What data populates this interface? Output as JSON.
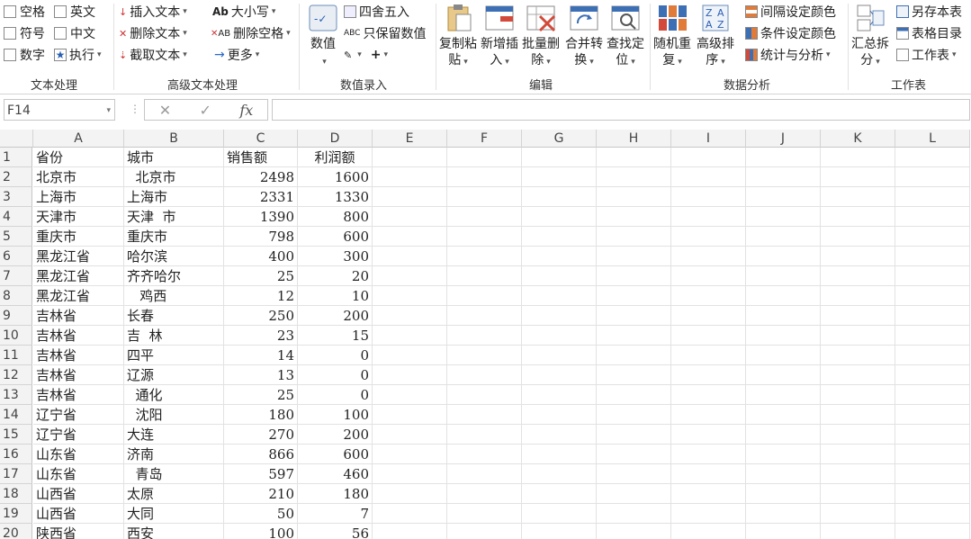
{
  "ribbon": {
    "text_group": {
      "label": "文本处理",
      "items": [
        [
          "空格",
          "英文"
        ],
        [
          "符号",
          "中文"
        ],
        [
          "数字",
          "执行"
        ]
      ]
    },
    "adv_text_group": {
      "label": "高级文本处理",
      "insert": "插入文本",
      "delete": "删除文本",
      "extract": "截取文本",
      "case": "大小写",
      "del_space": "删除空格",
      "more": "更多"
    },
    "numeric_group": {
      "label": "数值录入",
      "value_btn": "数值",
      "round": "四舍五入",
      "keep_value": "只保留数值"
    },
    "edit_group": {
      "label": "编辑",
      "buttons": [
        [
          "复制粘",
          "贴"
        ],
        [
          "新增插",
          "入"
        ],
        [
          "批量删",
          "除"
        ],
        [
          "合并转",
          "换"
        ],
        [
          "查找定",
          "位"
        ]
      ]
    },
    "analysis_group": {
      "label": "数据分析",
      "buttons": [
        [
          "随机重",
          "复"
        ],
        [
          "高级排",
          "序"
        ]
      ],
      "interval_color": "间隔设定颜色",
      "cond_color": "条件设定颜色",
      "stats": "统计与分析"
    },
    "sheet_group": {
      "label": "工作表",
      "summary": [
        "汇总拆",
        "分"
      ],
      "save_as": "另存本表",
      "catalog": "表格目录",
      "sheet": "工作表"
    }
  },
  "formula_bar": {
    "name_box": "F14",
    "cancel": "✕",
    "confirm": "✓",
    "fx": "fx",
    "value": ""
  },
  "columns": [
    "A",
    "B",
    "C",
    "D",
    "E",
    "F",
    "G",
    "H",
    "I",
    "J",
    "K",
    "L"
  ],
  "rows": [
    [
      "省份",
      "城市",
      "销售额",
      "利润额"
    ],
    [
      "北京市",
      "  北京市",
      "2498",
      "1600"
    ],
    [
      "上海市",
      "上海市",
      "2331",
      "1330"
    ],
    [
      "天津市",
      "天津  市",
      "1390",
      "800"
    ],
    [
      "重庆市",
      "重庆市",
      "798",
      "600"
    ],
    [
      "黑龙江省",
      "哈尔滨",
      "400",
      "300"
    ],
    [
      "黑龙江省",
      "齐齐哈尔",
      "25",
      "20"
    ],
    [
      "黑龙江省",
      "   鸡西",
      "12",
      "10"
    ],
    [
      "吉林省",
      "长春",
      "250",
      "200"
    ],
    [
      "吉林省",
      "吉  林",
      "23",
      "15"
    ],
    [
      "吉林省",
      "四平",
      "14",
      "0"
    ],
    [
      "吉林省",
      "辽源",
      "13",
      "0"
    ],
    [
      "吉林省",
      "  通化",
      "25",
      "0"
    ],
    [
      "辽宁省",
      "  沈阳",
      "180",
      "100"
    ],
    [
      "辽宁省",
      "大连",
      "270",
      "200"
    ],
    [
      "山东省",
      "济南",
      "866",
      "600"
    ],
    [
      "山东省",
      "  青岛",
      "597",
      "460"
    ],
    [
      "山西省",
      "太原",
      "210",
      "180"
    ],
    [
      "山西省",
      "大同",
      "50",
      "7"
    ],
    [
      "陕西省",
      "西安",
      "100",
      "56"
    ]
  ]
}
